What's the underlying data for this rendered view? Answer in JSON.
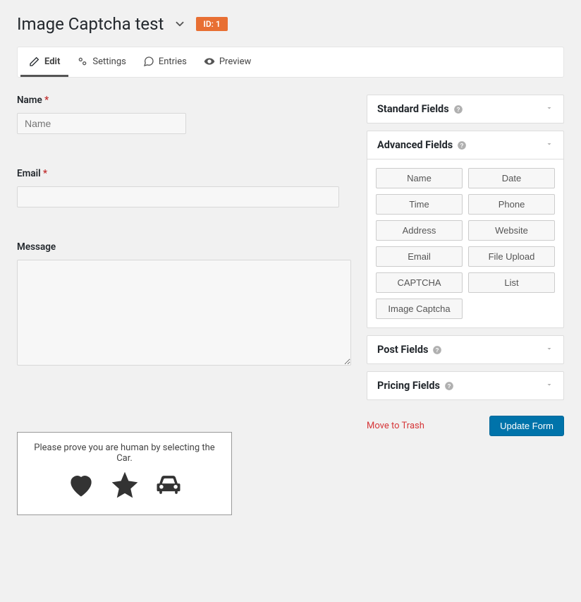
{
  "header": {
    "title": "Image Captcha test",
    "id_badge": "ID: 1"
  },
  "tabs": {
    "edit": "Edit",
    "settings": "Settings",
    "entries": "Entries",
    "preview": "Preview"
  },
  "form_canvas": {
    "name": {
      "label": "Name",
      "required": "*",
      "placeholder": "Name"
    },
    "email": {
      "label": "Email",
      "required": "*"
    },
    "message": {
      "label": "Message"
    }
  },
  "sidebar": {
    "standard_fields": {
      "title": "Standard Fields"
    },
    "advanced_fields": {
      "title": "Advanced Fields",
      "items": [
        "Name",
        "Date",
        "Time",
        "Phone",
        "Address",
        "Website",
        "Email",
        "File Upload",
        "CAPTCHA",
        "List",
        "Image Captcha"
      ]
    },
    "post_fields": {
      "title": "Post Fields"
    },
    "pricing_fields": {
      "title": "Pricing Fields"
    }
  },
  "actions": {
    "trash": "Move to Trash",
    "update": "Update Form"
  },
  "captcha": {
    "prompt": "Please prove you are human by selecting the Car."
  }
}
